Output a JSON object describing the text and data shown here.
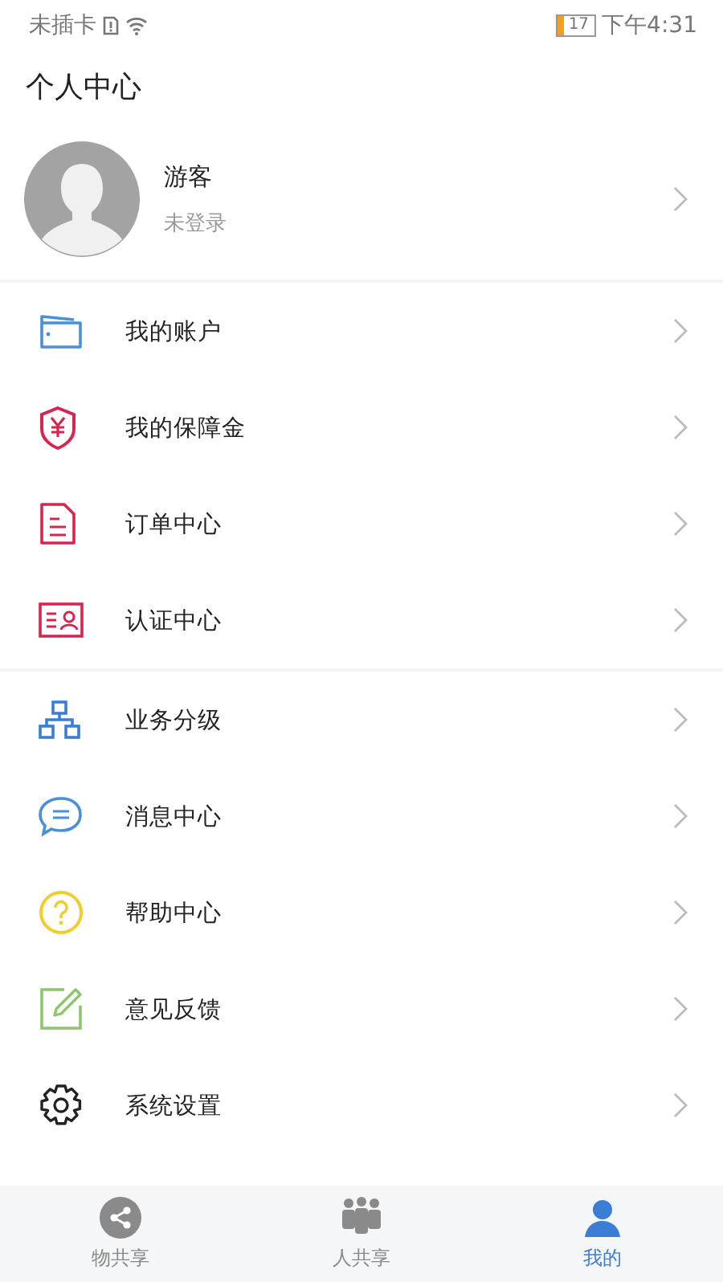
{
  "status_bar": {
    "carrier": "未插卡",
    "time": "下午4:31",
    "battery": "17"
  },
  "header": {
    "title": "个人中心"
  },
  "profile": {
    "name": "游客",
    "status": "未登录"
  },
  "menu_groups": [
    [
      {
        "label": "我的账户"
      },
      {
        "label": "我的保障金"
      },
      {
        "label": "订单中心"
      },
      {
        "label": "认证中心"
      }
    ],
    [
      {
        "label": "业务分级"
      },
      {
        "label": "消息中心"
      },
      {
        "label": "帮助中心"
      },
      {
        "label": "意见反馈"
      },
      {
        "label": "系统设置"
      }
    ]
  ],
  "tab_bar": [
    {
      "label": "物共享",
      "selected": false
    },
    {
      "label": "人共享",
      "selected": false
    },
    {
      "label": "我的",
      "selected": true
    }
  ]
}
